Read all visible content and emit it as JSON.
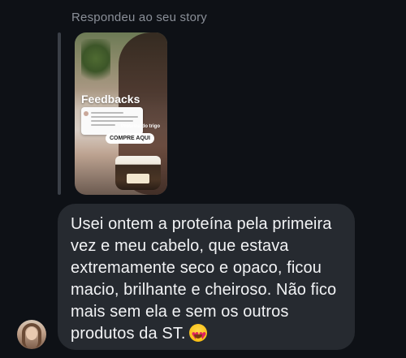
{
  "reply_header": "Respondeu ao seu story",
  "story": {
    "title": "Feedbacks",
    "tag": "Proteína do trigo",
    "cta": "COMPRE AQUI"
  },
  "message": {
    "text": "Usei ontem a proteína pela primeira vez e meu cabelo, que estava extremamente seco e opaco, ficou macio, brilhante e cheiroso. Não fico mais sem ela e sem os outros produtos da ST.",
    "emoji": "😍"
  },
  "colors": {
    "background": "#0e1116",
    "bubble": "#262a30",
    "text": "#f2f3f5",
    "muted": "#8a8f98"
  }
}
